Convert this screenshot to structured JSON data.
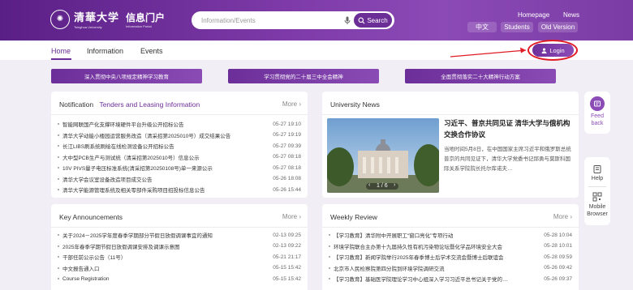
{
  "header": {
    "logo_cn": "清華大学",
    "logo_en": "Tsinghua University",
    "portal_cn": "信息门户",
    "portal_en": "Information Portal",
    "search_placeholder": "Information/Events",
    "search_button": "Search",
    "links": {
      "homepage": "Homepage",
      "news": "News",
      "chinese": "中文",
      "students": "Students",
      "old_version": "Old Version"
    }
  },
  "nav": {
    "items": [
      "Home",
      "Information",
      "Events"
    ],
    "active": "Home",
    "login": "Login"
  },
  "banners": [
    "深入贯彻中央八项规定精神学习教育",
    "学习贯彻党的二十届三中全会精神",
    "全面贯彻落实二十大精神行动方案"
  ],
  "notification": {
    "title": "Notification",
    "tab": "Tenders and Leasing Information",
    "more": "More",
    "items": [
      {
        "text": "智能网联国产化支撑环境硬件平台升级公开招标公告",
        "date": "05-27 19:10"
      },
      {
        "text": "清华大学动能小楼园运营服务改造（清采招第2025010号）成交结果公告",
        "date": "05-27 19:19"
      },
      {
        "text": "长江LIBS刷系统刷绘在线检测设备公开招标公告",
        "date": "05-27 09:39"
      },
      {
        "text": "大中型PCB生产与测试统（清采招第2025010号）信息公示",
        "date": "05-27 08:18"
      },
      {
        "text": "10V PIVS量子电压标准系统(清采招第20250108号)单一来源公示",
        "date": "05-27 08:18"
      },
      {
        "text": "清华大学会议室设备改造项目成交公告",
        "date": "05-26 18:08"
      },
      {
        "text": "清华大学能源管理系统及相关零部件采购项目招投标信息公告",
        "date": "05-26 15:44"
      }
    ]
  },
  "university_news": {
    "title": "University News",
    "headline": "习近平、普京共同见证 清华大学与俄机构交换合作协议",
    "body": "当地时间5月8日，在中国国家主席习近平和俄罗斯总统普京的共同见证下，清华大学党委书记邱勇与莫斯科国际关系学院院长托尔库诺夫…",
    "slide_current": "1",
    "slide_total": "6"
  },
  "announcements": {
    "title": "Key Announcements",
    "more": "More",
    "items": [
      {
        "text": "关于2024－2025学年度春季学期部分节假日放假调课事宜的通知",
        "date": "02-13 09:25"
      },
      {
        "text": "2025年春季学期节假日放假调课安排及调课示意图",
        "date": "02-13 09:22"
      },
      {
        "text": "干部任前公示公告（11号）",
        "date": "05-21 21:17"
      },
      {
        "text": "中文报告通入口",
        "date": "05-15 15:42"
      },
      {
        "text": "Course Registration",
        "date": "05-15 15:42"
      }
    ]
  },
  "weekly_review": {
    "title": "Weekly Review",
    "more": "More",
    "items": [
      {
        "text": "【学习教育】清华附中开展职工“窗口亮化”专项行动",
        "date": "05-28 10:04"
      },
      {
        "text": "环境学院联合主办第十九届持久性有机污染物论坛暨化学品环境安全大会",
        "date": "05-28 10:01"
      },
      {
        "text": "【学习教育】新闻学院举行2025年春季博士后学术交流会暨博士后联谊会",
        "date": "05-28 09:59"
      },
      {
        "text": "北京市人民检察院第四分院到环境学院调研交流",
        "date": "05-26 09:42"
      },
      {
        "text": "【学习教育】基础医学院理论学习中心组深入学习习近平总书记关于党的…",
        "date": "05-26 09:37"
      }
    ]
  },
  "side": {
    "feedback": "Feed back",
    "help": "Help",
    "mobile": "Mobile Browser"
  },
  "colors": {
    "primary": "#6b2d96",
    "accent_red": "#e01b24"
  }
}
